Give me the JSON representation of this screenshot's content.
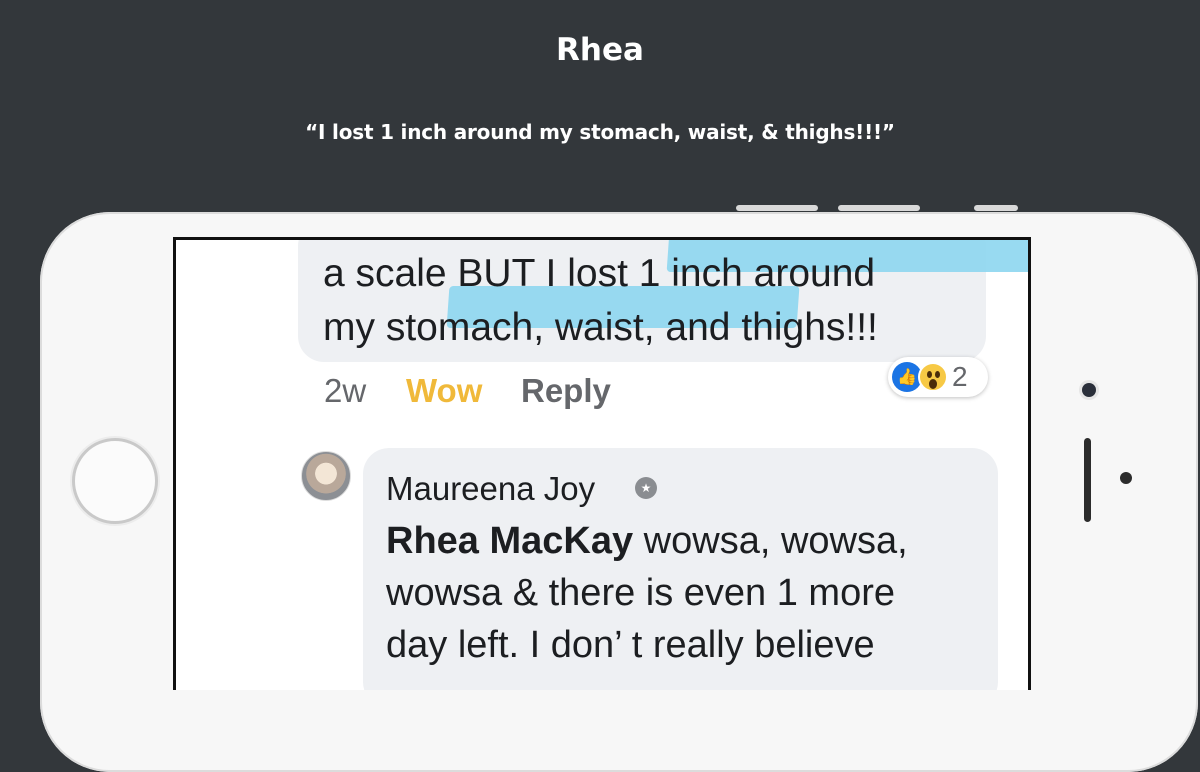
{
  "slide": {
    "title": "Rhea",
    "quote": "“I lost 1 inch around my stomach, waist, & thighs!!!”"
  },
  "comment": {
    "line1_plain": "a scale BUT ",
    "line1_highlight": "I lost 1 inch around",
    "line2_highlight": "my stomach, waist,",
    "line2_plain": " and thighs!!!",
    "time": "2w",
    "wow_label": "Wow",
    "reply_label": "Reply",
    "reaction_count": "2",
    "highlight_color": "#8dd6f0"
  },
  "reply": {
    "author": "Maureena Joy",
    "mention": "Rhea MacKay",
    "line1_rest": " wowsa, wowsa,",
    "line2": "wowsa & there is even 1 more",
    "line3": "day left.  I don’ t really believe"
  },
  "icons": {
    "like": "like-icon",
    "wow": "wow-icon",
    "badge": "shield-badge-icon"
  }
}
